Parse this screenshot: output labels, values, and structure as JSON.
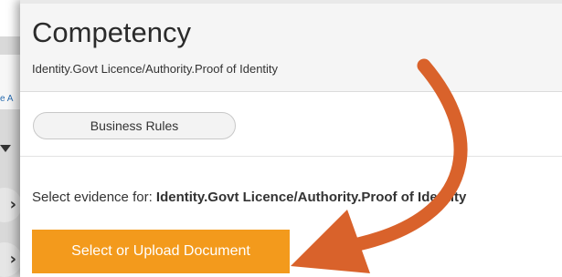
{
  "background": {
    "link_fragment": "e A",
    "colors": {
      "link": "#2a6db0"
    }
  },
  "modal": {
    "title": "Competency",
    "subtitle": "Identity.Govt Licence/Authority.Proof of Identity",
    "business_rules_label": "Business Rules",
    "evidence_prompt": "Select evidence for:",
    "evidence_target": "Identity.Govt Licence/Authority.Proof of Identity",
    "upload_button_label": "Select or Upload Document",
    "colors": {
      "upload_button": "#f39a1c",
      "annotation_arrow": "#d9622b"
    }
  },
  "icons": {
    "caret": "caret-down-icon",
    "chevron": "chevron-right-icon",
    "annotation": "curved-arrow-annotation"
  }
}
